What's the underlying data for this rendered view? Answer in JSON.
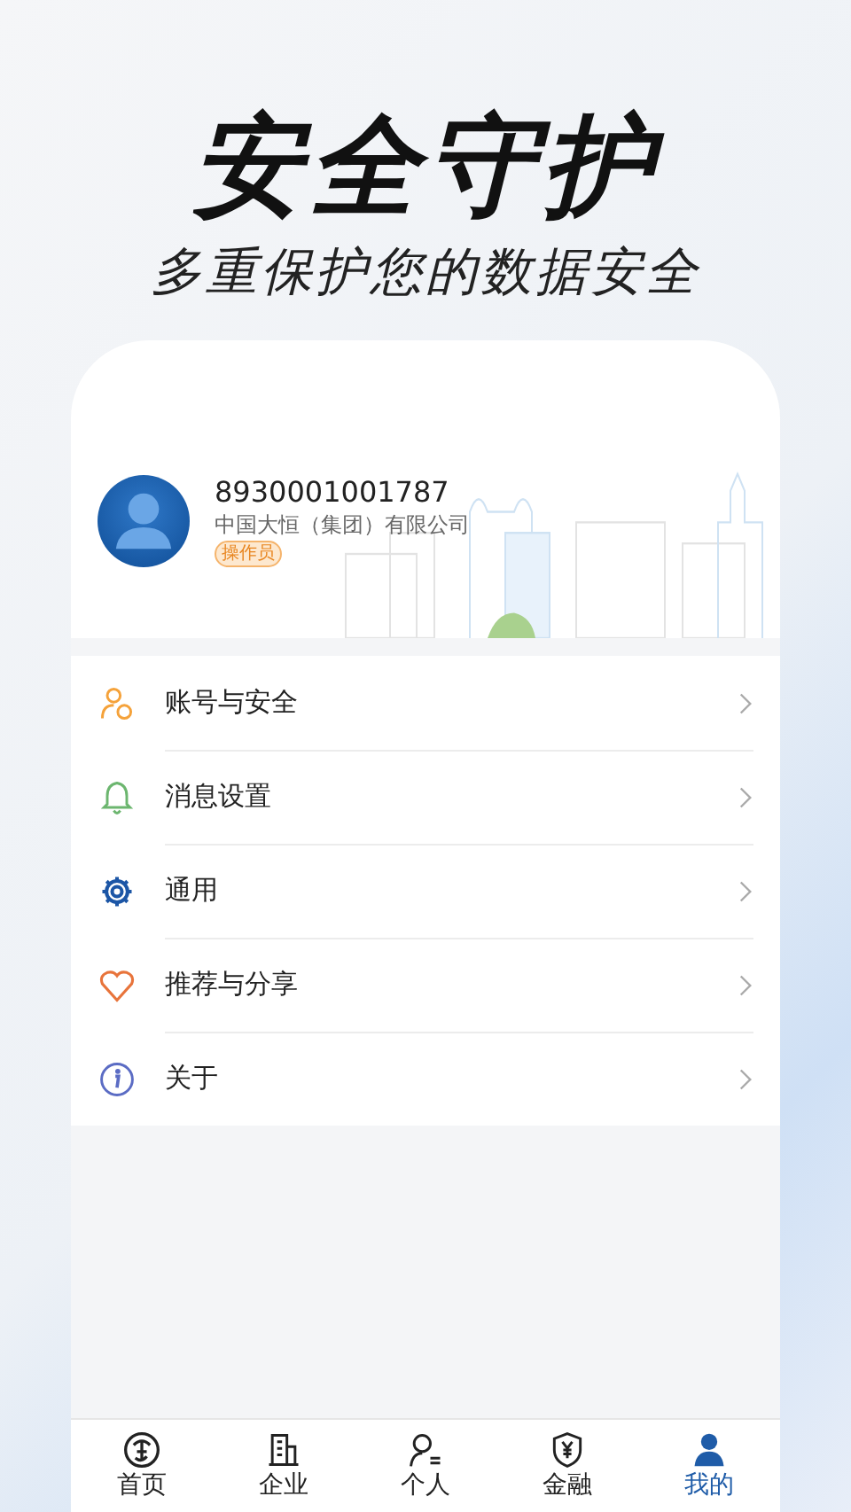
{
  "headline": "安全守护",
  "subtitle": "多重保护您的数据安全",
  "profile": {
    "account": "8930001001787",
    "company": "中国大恒（集团）有限公司",
    "role": "操作员"
  },
  "menu": [
    {
      "kind": "account",
      "label": "账号与安全"
    },
    {
      "kind": "bell",
      "label": "消息设置"
    },
    {
      "kind": "gear",
      "label": "通用"
    },
    {
      "kind": "heart",
      "label": "推荐与分享"
    },
    {
      "kind": "info",
      "label": "关于"
    }
  ],
  "tabs": [
    {
      "kind": "home",
      "label": "首页",
      "selected": false
    },
    {
      "kind": "company",
      "label": "企业",
      "selected": false
    },
    {
      "kind": "person",
      "label": "个人",
      "selected": false
    },
    {
      "kind": "finance",
      "label": "金融",
      "selected": false
    },
    {
      "kind": "mine",
      "label": "我的",
      "selected": true
    }
  ]
}
